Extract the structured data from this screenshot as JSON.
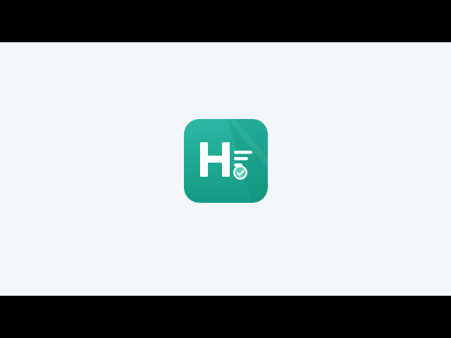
{
  "screen": {
    "background_color": "#f3f7fa",
    "letterbox_color": "#000000"
  },
  "app_icon": {
    "icon": "app-logo-icon",
    "glyph": "H",
    "accent_colors": {
      "tile_top": "#2bb8a3",
      "tile_bottom": "#149a83",
      "fold_shade": "#1a9a84",
      "glyph": "#ffffff",
      "check_badge": "#5ad0b4"
    }
  }
}
